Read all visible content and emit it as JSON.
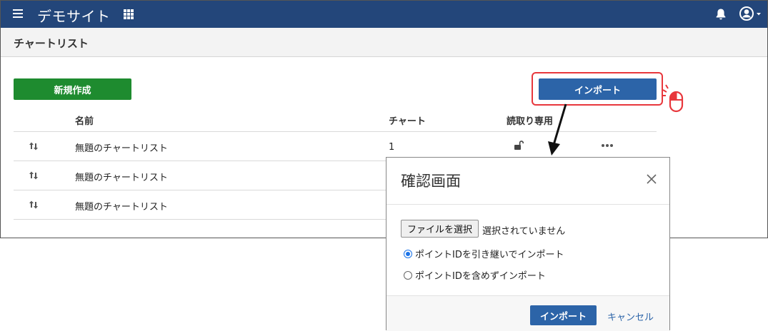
{
  "header": {
    "site_title": "デモサイト",
    "menu_icon": "hamburger-icon",
    "apps_icon": "grid-icon",
    "notification_icon": "bell-icon",
    "user_icon": "user-circle-icon",
    "brand_color": "#23467a"
  },
  "page": {
    "title": "チャートリスト"
  },
  "toolbar": {
    "new_label": "新規作成",
    "import_label": "インポート",
    "new_color": "#1e8b2f",
    "import_color": "#2c64a8",
    "highlight_color": "#e8373c"
  },
  "table": {
    "columns": [
      "名前",
      "チャート",
      "読取り専用"
    ],
    "rows": [
      {
        "name": "無題のチャートリスト",
        "charts": "1",
        "readonly_icon": "unlock-icon",
        "actions_icon": "more-icon"
      },
      {
        "name": "無題のチャートリスト",
        "charts": "",
        "readonly_icon": "",
        "actions_icon": ""
      },
      {
        "name": "無題のチャートリスト",
        "charts": "",
        "readonly_icon": "",
        "actions_icon": ""
      }
    ]
  },
  "dialog": {
    "title": "確認画面",
    "file_button": "ファイルを選択",
    "file_status": "選択されていません",
    "options": [
      {
        "label": "ポイントIDを引き継いでインポート",
        "checked": true
      },
      {
        "label": "ポイントIDを含めずインポート",
        "checked": false
      }
    ],
    "import_label": "インポート",
    "cancel_label": "キャンセル"
  }
}
